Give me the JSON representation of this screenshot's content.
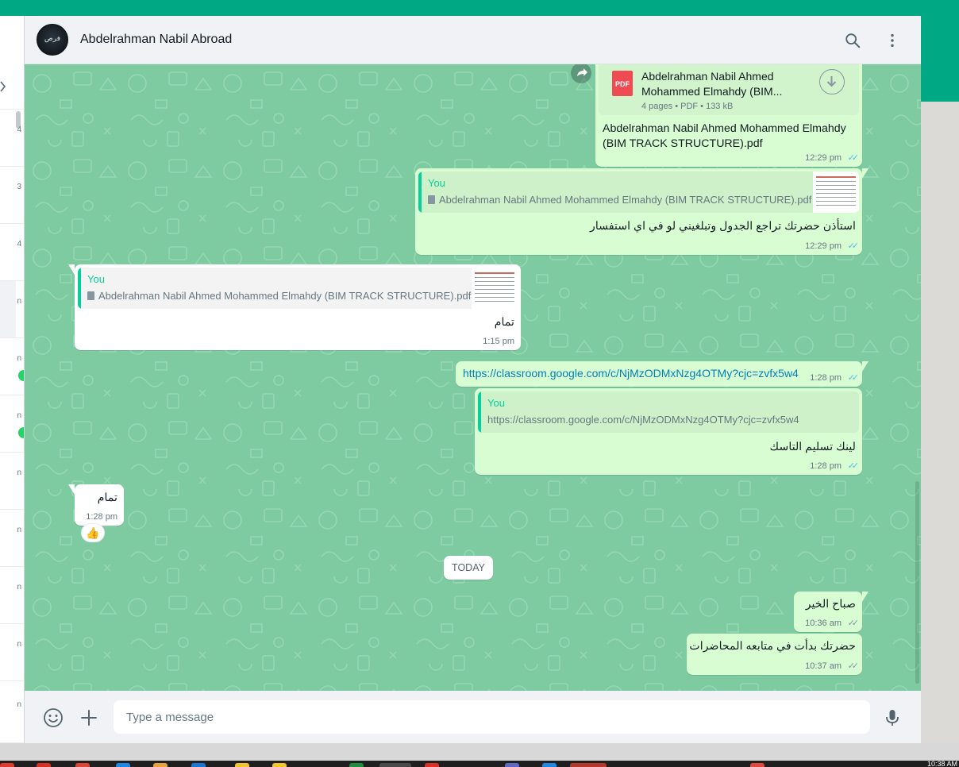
{
  "chat": {
    "contact_name": "Abdelrahman Nabil Abroad",
    "avatar_text": "فرص",
    "search_icon": "search-icon",
    "menu_icon": "kebab-menu-icon"
  },
  "left_panel_fragments": [
    "4",
    "3",
    "4",
    "n",
    "n",
    "n",
    "n",
    "n",
    "n",
    "n",
    "n"
  ],
  "messages": {
    "m1": {
      "doc_title": "Abdelrahman Nabil Ahmed Mohammed Elmahdy (BIM...",
      "doc_meta": "4 pages • PDF • 133 kB",
      "pdf_label": "PDF",
      "caption": "Abdelrahman Nabil Ahmed Mohammed Elmahdy (BIM TRACK STRUCTURE).pdf",
      "time": "12:29 pm"
    },
    "m2": {
      "quote_name": "You",
      "quote_text": "Abdelrahman Nabil Ahmed Mohammed Elmahdy (BIM TRACK STRUCTURE).pdf",
      "text": "استأذن حضرتك تراجع  الجدول وتبلغيني لو في اي استفسار",
      "time": "12:29 pm"
    },
    "m3": {
      "quote_name": "You",
      "quote_text": "Abdelrahman Nabil Ahmed Mohammed Elmahdy (BIM TRACK STRUCTURE).pdf",
      "text": "تمام",
      "time": "1:15 pm"
    },
    "m4": {
      "link": "https://classroom.google.com/c/NjMzODMxNzg4OTMy?cjc=zvfx5w4",
      "time": "1:28 pm"
    },
    "m5": {
      "quote_name": "You",
      "quote_text": "https://classroom.google.com/c/NjMzODMxNzg4OTMy?cjc=zvfx5w4",
      "text": "لينك تسليم التاسك",
      "time": "1:28 pm"
    },
    "m6": {
      "text": "تمام",
      "time": "1:28 pm",
      "reaction": "👍"
    },
    "date_chip": "TODAY",
    "m7": {
      "text": "صباح الخير",
      "time": "10:36 am"
    },
    "m8": {
      "text": "حضرتك بدأت في متابعه المحاضرات",
      "time": "10:37 am"
    }
  },
  "composer": {
    "placeholder": "Type a message",
    "emoji_icon": "emoji-icon",
    "attach_icon": "plus-icon",
    "mic_icon": "microphone-icon"
  },
  "colors": {
    "accent": "#00a884",
    "chat_bg": "#7ecba1",
    "outgoing_bubble": "#d9fdd3",
    "incoming_bubble": "#ffffff",
    "read_ticks": "#53bdeb",
    "quote_name": "#06cf9c",
    "link": "#027eb5"
  },
  "taskbar": {
    "clock": "10:38 AM"
  }
}
